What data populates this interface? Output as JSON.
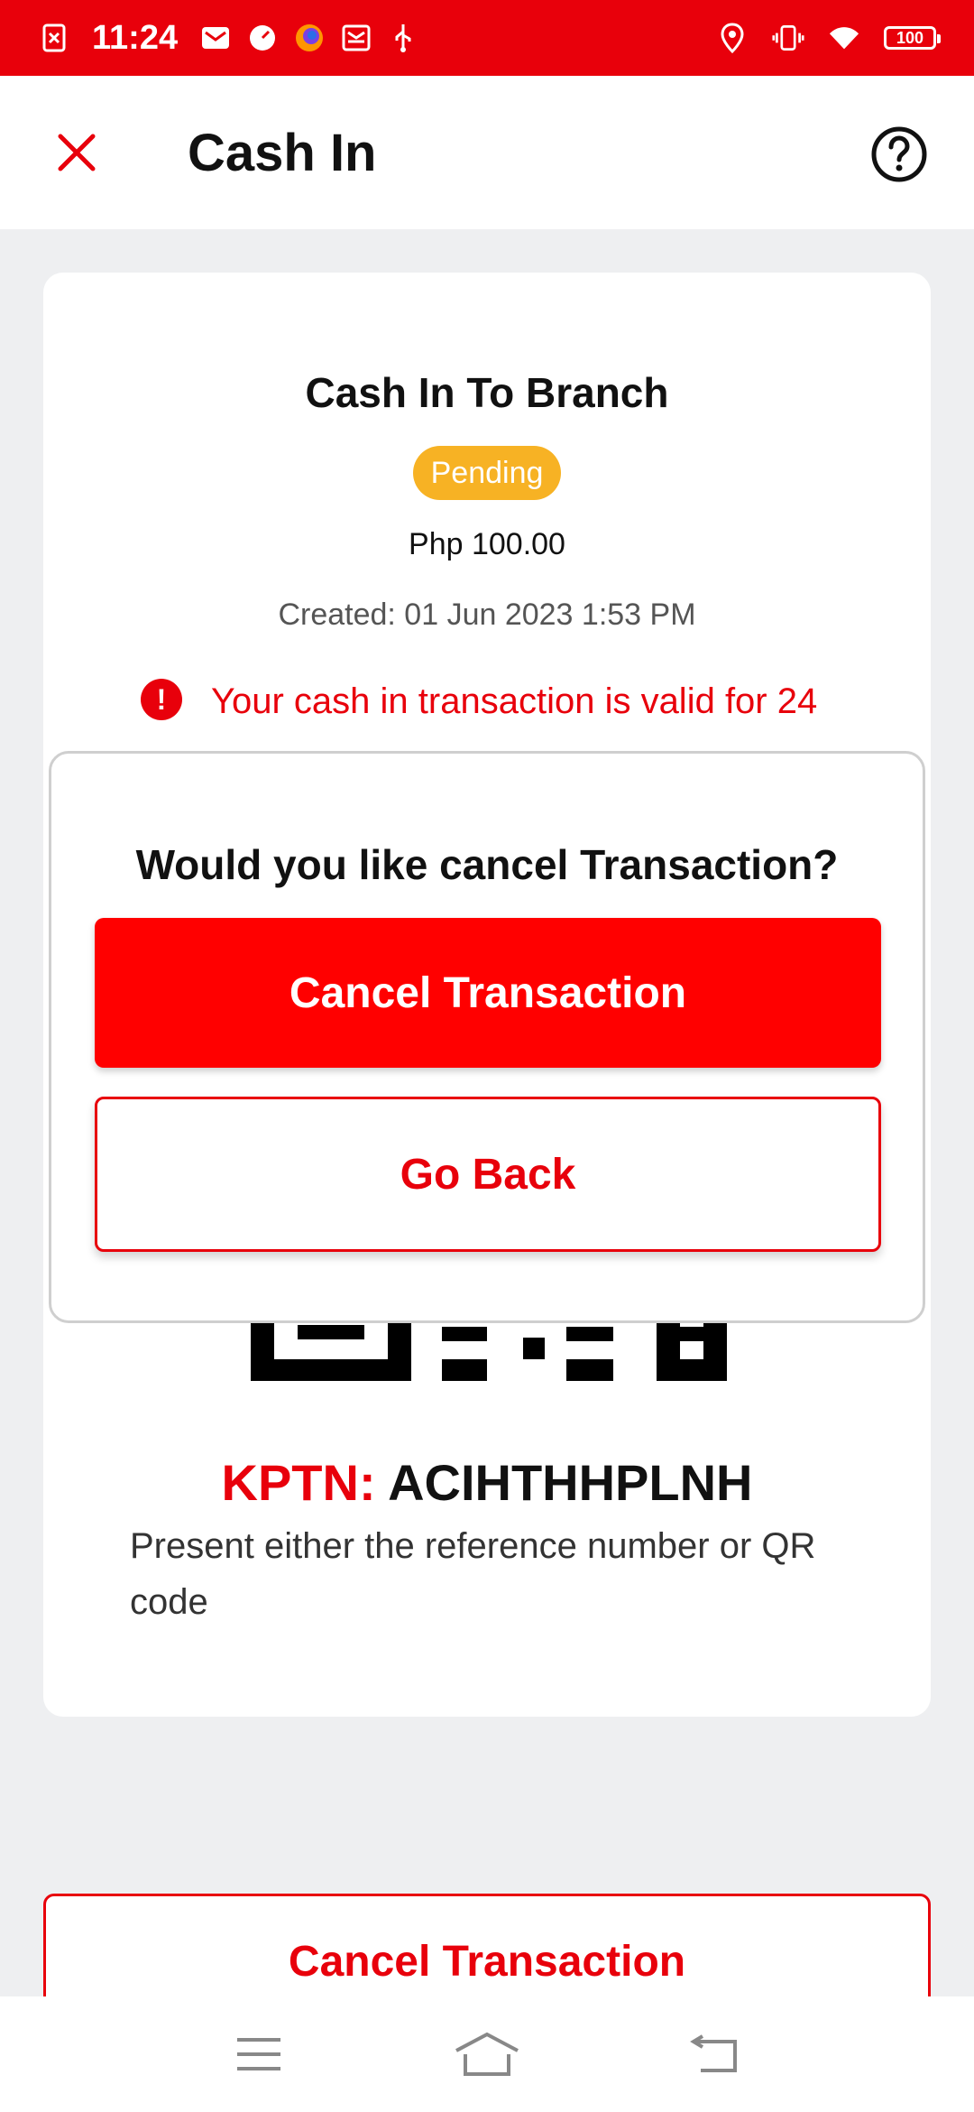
{
  "status_bar": {
    "time": "11:24",
    "battery": "100",
    "left_icons": [
      "screenshot-icon",
      "mail-icon",
      "speed-icon",
      "firefox-icon",
      "inbox-icon",
      "usb-icon"
    ],
    "right_icons": [
      "location-icon",
      "vibrate-icon",
      "wifi-icon",
      "battery-icon"
    ]
  },
  "header": {
    "title": "Cash In",
    "close_icon": "close-icon",
    "help_icon": "help-icon"
  },
  "card": {
    "title": "Cash In To Branch",
    "status": "Pending",
    "amount": "Php 100.00",
    "created": "Created: 01 Jun 2023 1:53 PM",
    "warning": "Your cash in transaction is valid for 24",
    "kptn_label": "KPTN:",
    "kptn_value": "ACIHTHHPLNH",
    "reference_note": "Present either the reference number or QR code"
  },
  "modal": {
    "title": "Would you like cancel Transaction?",
    "cancel_label": "Cancel Transaction",
    "back_label": "Go Back"
  },
  "bottom": {
    "cancel_label": "Cancel Transaction"
  },
  "nav_bar": {
    "items": [
      "menu-icon",
      "home-icon",
      "back-icon"
    ]
  },
  "colors": {
    "brand_red": "#e8000b",
    "pending": "#f7b224"
  }
}
